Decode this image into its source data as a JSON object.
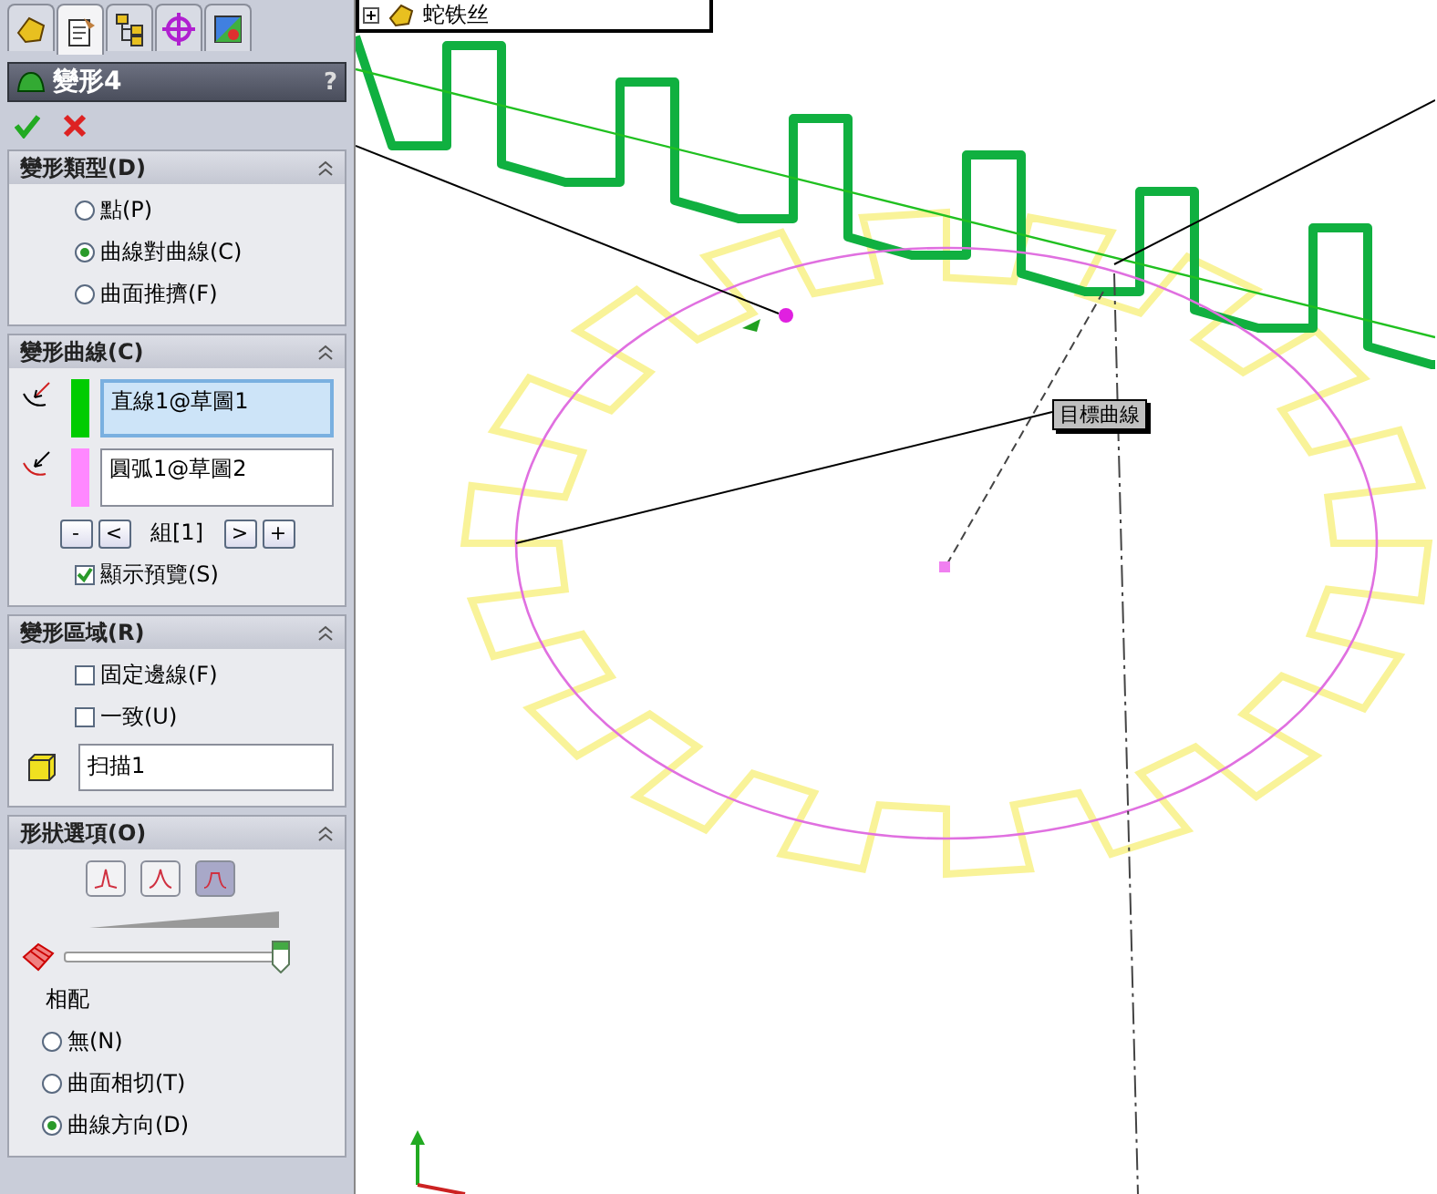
{
  "tabs": [
    {
      "kind": "feature",
      "selected": false
    },
    {
      "kind": "property",
      "selected": true
    },
    {
      "kind": "config",
      "selected": false
    },
    {
      "kind": "target",
      "selected": false
    },
    {
      "kind": "display",
      "selected": false
    }
  ],
  "title": {
    "text": "變形4",
    "help": "?"
  },
  "sections": [
    {
      "kind": "radios",
      "title": "變形類型(D)",
      "items": [
        {
          "label": "點(P)",
          "selected": false
        },
        {
          "label": "曲線對曲線(C)",
          "selected": true
        },
        {
          "label": "曲面推擠(F)",
          "selected": false
        }
      ]
    },
    {
      "kind": "curves",
      "title": "變形曲線(C)",
      "lists": [
        {
          "value": "直線1@草圖1",
          "color": "#00cc00",
          "selected": true
        },
        {
          "value": "圓弧1@草圖2",
          "color": "#ff88ff",
          "selected": false
        }
      ],
      "buttons": [
        "-",
        "<",
        ">",
        "+"
      ],
      "group": "組[1]",
      "checks": [
        {
          "label": "顯示預覽(S)",
          "checked": true
        }
      ]
    },
    {
      "kind": "region",
      "title": "變形區域(R)",
      "checks": [
        {
          "label": "固定邊線(F)",
          "checked": false
        },
        {
          "label": "一致(U)",
          "checked": false
        }
      ],
      "field": "扫描1"
    },
    {
      "kind": "shape",
      "title": "形狀選項(O)",
      "shapes": [
        {
          "selected": false
        },
        {
          "selected": false
        },
        {
          "selected": true
        }
      ],
      "slider": {
        "level": 0.97
      },
      "caption": "相配",
      "items": [
        {
          "label": "無(N)",
          "selected": false
        },
        {
          "label": "曲面相切(T)",
          "selected": false
        },
        {
          "label": "曲線方向(D)",
          "selected": true
        }
      ]
    }
  ],
  "tree": {
    "label": "蛇铁丝"
  },
  "tooltip": "目標曲線"
}
